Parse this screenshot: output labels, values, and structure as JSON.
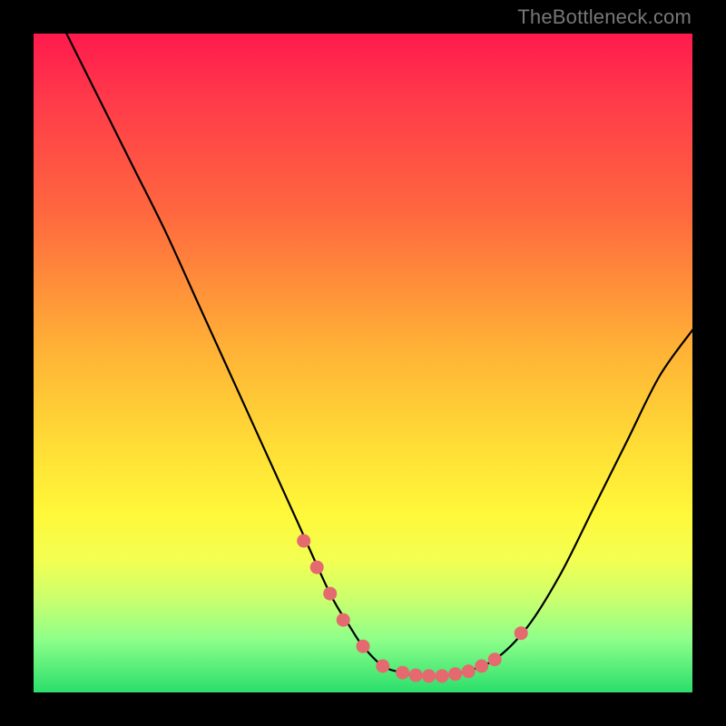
{
  "attribution": "TheBottleneck.com",
  "chart_data": {
    "type": "line",
    "title": "",
    "xlabel": "",
    "ylabel": "",
    "xlim": [
      0,
      100
    ],
    "ylim": [
      0,
      100
    ],
    "grid": false,
    "legend": false,
    "series": [
      {
        "name": "bottleneck-curve",
        "x": [
          5,
          10,
          15,
          20,
          25,
          30,
          35,
          40,
          45,
          48,
          50,
          53,
          56,
          59,
          62,
          65,
          70,
          75,
          80,
          85,
          90,
          95,
          100
        ],
        "y": [
          100,
          90,
          80,
          70,
          59,
          48,
          37,
          26,
          15,
          10,
          7,
          4,
          3,
          2.5,
          2.5,
          3,
          5,
          10,
          18,
          28,
          38,
          48,
          55
        ]
      }
    ],
    "markers": {
      "name": "highlight-points",
      "color": "#e46a6f",
      "x": [
        41,
        43,
        45,
        47,
        50,
        53,
        56,
        58,
        60,
        62,
        64,
        66,
        68,
        70,
        74
      ],
      "y": [
        23,
        19,
        15,
        11,
        7,
        4,
        3,
        2.6,
        2.5,
        2.5,
        2.8,
        3.2,
        4,
        5,
        9
      ]
    }
  }
}
